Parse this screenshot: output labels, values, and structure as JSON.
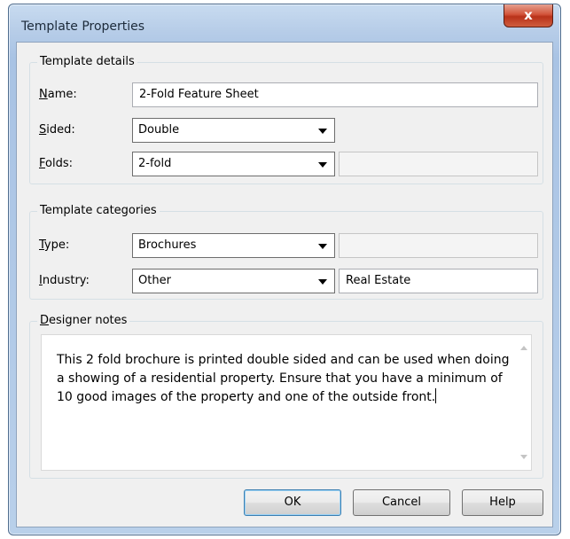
{
  "window": {
    "title": "Template Properties",
    "close_glyph": "x"
  },
  "template_details": {
    "legend": "Template details",
    "name": {
      "label_key": "N",
      "label_rest": "ame:",
      "value": "2-Fold Feature Sheet"
    },
    "sided": {
      "label_key": "S",
      "label_rest": "ided:",
      "value": "Double"
    },
    "folds": {
      "label_key": "F",
      "label_rest": "olds:",
      "value": "2-fold",
      "extra_value": ""
    }
  },
  "template_categories": {
    "legend": "Template categories",
    "type": {
      "label_key": "T",
      "label_rest": "ype:",
      "value": "Brochures",
      "extra_value": ""
    },
    "industry": {
      "label_key": "I",
      "label_rest": "ndustry:",
      "value": "Other",
      "extra_value": "Real Estate"
    }
  },
  "designer_notes": {
    "legend_key": "D",
    "legend_rest": "esigner notes",
    "text": "This 2 fold brochure is printed double sided and can be used when doing a showing of a residential property. Ensure that you have a minimum of 10 good images of the property and one of the outside front."
  },
  "buttons": {
    "ok": "OK",
    "cancel": "Cancel",
    "help": "Help"
  },
  "icons": {
    "close": "close-icon",
    "dropdown": "chevron-down-icon",
    "scroll_up": "scroll-up-arrow-icon",
    "scroll_down": "scroll-down-arrow-icon"
  }
}
